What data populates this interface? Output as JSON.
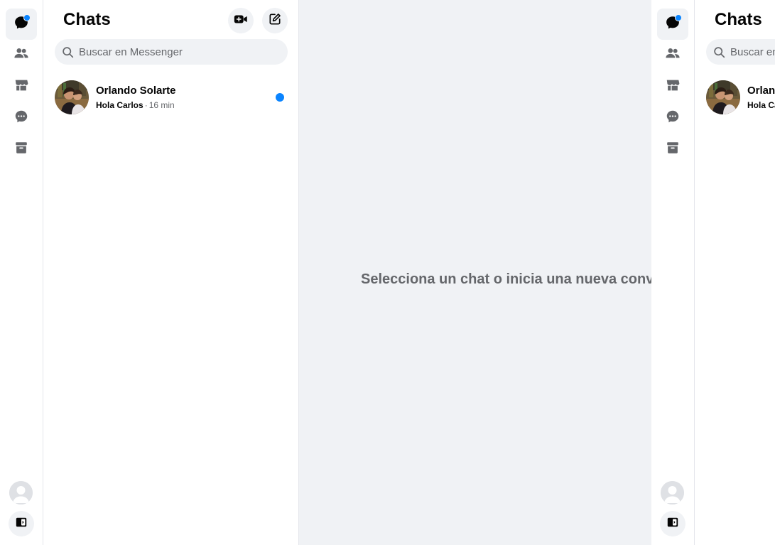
{
  "sidebar": {
    "items": [
      {
        "name": "chats",
        "icon": "chat-bubble-icon",
        "active": true,
        "badge": true
      },
      {
        "name": "people",
        "icon": "people-icon"
      },
      {
        "name": "marketplace",
        "icon": "store-icon"
      },
      {
        "name": "requests",
        "icon": "message-dots-icon"
      },
      {
        "name": "archived",
        "icon": "archive-icon"
      }
    ],
    "bottom": {
      "avatar_icon": "default-avatar-icon",
      "toggle_icon": "sidebar-toggle-icon"
    }
  },
  "chat_list": {
    "title": "Chats",
    "actions": [
      {
        "name": "new-video-call",
        "icon": "video-plus-icon"
      },
      {
        "name": "new-message",
        "icon": "compose-icon"
      }
    ],
    "search": {
      "placeholder": "Buscar en Messenger",
      "value": ""
    },
    "conversations": [
      {
        "name": "Orlando Solarte",
        "last_message": "Hola Carlos",
        "separator": "·",
        "time": "16 min",
        "unread": true
      }
    ]
  },
  "main": {
    "empty_text": "Selecciona un chat o inicia una nueva conversación"
  },
  "colors": {
    "accent": "#0a84ff",
    "panel_bg": "#f0f2f5",
    "text_primary": "#050505",
    "text_secondary": "#65676b"
  }
}
